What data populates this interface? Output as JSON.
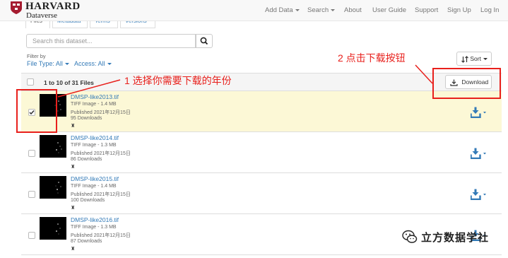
{
  "brand": {
    "name": "HARVARD",
    "sub": "Dataverse"
  },
  "nav": {
    "add_data": "Add Data",
    "search": "Search",
    "about": "About",
    "user_guide": "User Guide",
    "support": "Support",
    "sign_up": "Sign Up",
    "log_in": "Log In"
  },
  "tabs": [
    "Files",
    "Metadata",
    "Terms",
    "Versions"
  ],
  "search": {
    "placeholder": "Search this dataset..."
  },
  "filters": {
    "label": "Filter by",
    "file_type": "File Type: All",
    "access": "Access: All"
  },
  "sort": {
    "label": "Sort"
  },
  "table": {
    "count_label": "1 to 10 of 31 Files",
    "download_label": "Download"
  },
  "files": [
    {
      "name": "DMSP-like2013.tif",
      "type": "TIFF Image - 1.4 MB",
      "published": "Published 2021年12月15日",
      "downloads": "95 Downloads",
      "selected": true
    },
    {
      "name": "DMSP-like2014.tif",
      "type": "TIFF Image - 1.3 MB",
      "published": "Published 2021年12月15日",
      "downloads": "86 Downloads",
      "selected": false
    },
    {
      "name": "DMSP-like2015.tif",
      "type": "TIFF Image - 1.4 MB",
      "published": "Published 2021年12月15日",
      "downloads": "100 Downloads",
      "selected": false
    },
    {
      "name": "DMSP-like2016.tif",
      "type": "TIFF Image - 1.3 MB",
      "published": "Published 2021年12月15日",
      "downloads": "87 Downloads",
      "selected": false
    }
  ],
  "annotations": {
    "step1": "1 选择你需要下载的年份",
    "step2": "2 点击下载按钮",
    "color": "#e8201c"
  },
  "watermark": {
    "text": "立方数据学社"
  },
  "colors": {
    "link": "#337ab7",
    "selected_row": "#fcf8d6",
    "download_icon": "#337ab7"
  }
}
